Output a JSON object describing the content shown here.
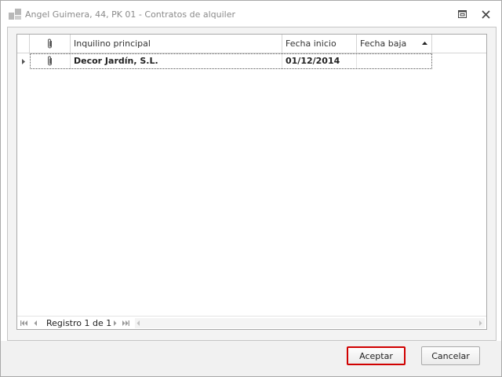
{
  "window": {
    "title": "Angel Guimera, 44, PK 01 - Contratos de alquiler"
  },
  "grid": {
    "columns": [
      {
        "key": "attachment",
        "label": ""
      },
      {
        "key": "inquilino",
        "label": "Inquilino principal"
      },
      {
        "key": "fecha_inicio",
        "label": "Fecha inicio"
      },
      {
        "key": "fecha_baja",
        "label": "Fecha baja"
      }
    ],
    "sort": {
      "column": "fecha_baja",
      "direction": "ascending"
    },
    "rows": [
      {
        "inquilino": "Decor Jardín, S.L.",
        "fecha_inicio": "01/12/2014",
        "fecha_baja": ""
      }
    ]
  },
  "navigator": {
    "record_text": "Registro 1 de 1"
  },
  "buttons": {
    "accept": "Aceptar",
    "cancel": "Cancelar"
  },
  "colors": {
    "accept_highlight": "#d00000",
    "grid_border": "#a9a9a9"
  }
}
